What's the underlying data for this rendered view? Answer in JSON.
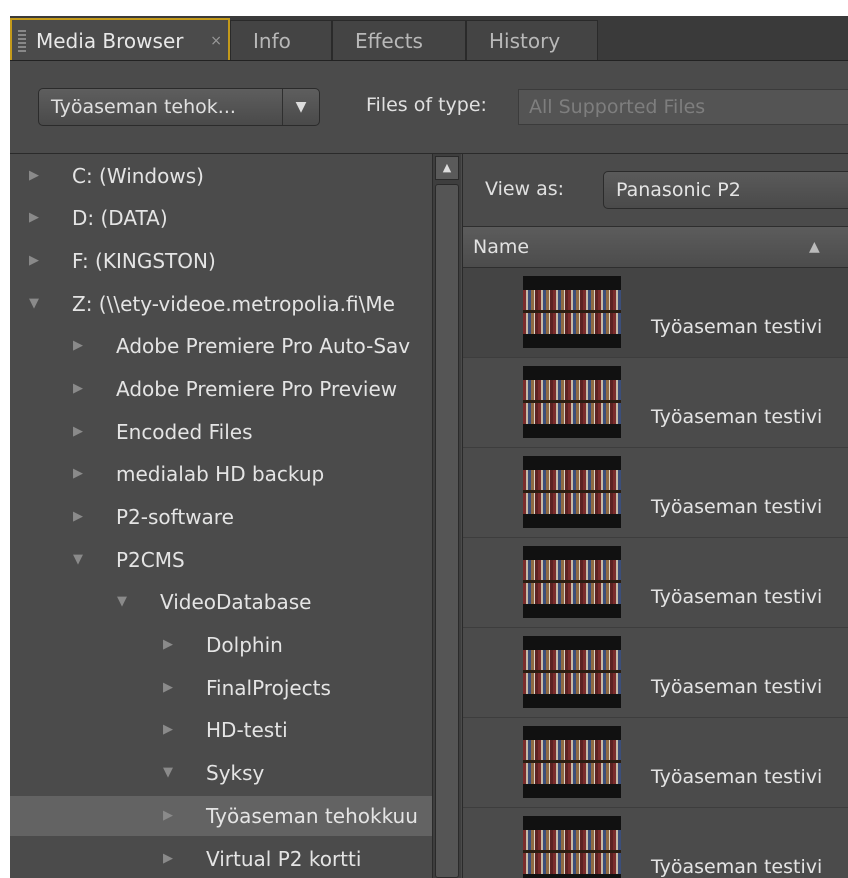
{
  "tabs": [
    {
      "label": "Media Browser",
      "active": true
    },
    {
      "label": "Info"
    },
    {
      "label": "Effects"
    },
    {
      "label": "History"
    }
  ],
  "toolbar": {
    "location_dropdown": "Työaseman tehok...",
    "files_of_type_label": "Files of type:",
    "files_of_type_value": "All Supported Files"
  },
  "tree": [
    {
      "label": "C: (Windows)",
      "expanded": false
    },
    {
      "label": "D: (DATA)",
      "expanded": false
    },
    {
      "label": "F: (KINGSTON)",
      "expanded": false
    },
    {
      "label": "Z: (\\\\ety-videoe.metropolia.fi\\Me",
      "expanded": true
    },
    {
      "label": "Adobe Premiere Pro Auto-Sav",
      "expanded": false
    },
    {
      "label": "Adobe Premiere Pro Preview",
      "expanded": false
    },
    {
      "label": "Encoded Files",
      "expanded": false
    },
    {
      "label": "medialab HD backup",
      "expanded": false
    },
    {
      "label": "P2-software",
      "expanded": false
    },
    {
      "label": "P2CMS",
      "expanded": true
    },
    {
      "label": "VideoDatabase",
      "expanded": true
    },
    {
      "label": "Dolphin",
      "expanded": false
    },
    {
      "label": "FinalProjects",
      "expanded": false
    },
    {
      "label": "HD-testi",
      "expanded": false
    },
    {
      "label": "Syksy",
      "expanded": true
    },
    {
      "label": "Työaseman tehokkuu",
      "expanded": false,
      "selected": true
    },
    {
      "label": "Virtual P2 kortti",
      "expanded": false
    }
  ],
  "view": {
    "view_as_label": "View as:",
    "view_as_value": "Panasonic P2",
    "name_column": "Name"
  },
  "clips": [
    {
      "name": "Työaseman testivi"
    },
    {
      "name": "Työaseman testivi"
    },
    {
      "name": "Työaseman testivi"
    },
    {
      "name": "Työaseman testivi"
    },
    {
      "name": "Työaseman testivi"
    },
    {
      "name": "Työaseman testivi"
    },
    {
      "name": "Työaseman testivi"
    }
  ],
  "icons": {
    "expand": "triangle-right-icon",
    "collapse": "triangle-down-icon",
    "sort": "sort-ascending-icon",
    "close": "close-icon"
  }
}
